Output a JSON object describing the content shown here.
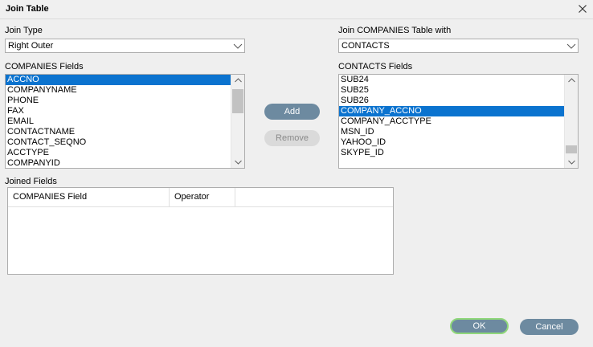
{
  "window": {
    "title": "Join Table",
    "close_icon": "close-icon"
  },
  "join_type": {
    "label": "Join Type",
    "value": "Right Outer"
  },
  "join_with": {
    "label": "Join COMPANIES Table with",
    "value": "CONTACTS"
  },
  "left_list": {
    "label": "COMPANIES Fields",
    "items": [
      "ACCNO",
      "COMPANYNAME",
      "PHONE",
      "FAX",
      "EMAIL",
      "CONTACTNAME",
      "CONTACT_SEQNO",
      "ACCTYPE",
      "COMPANYID"
    ],
    "selected_index": 0
  },
  "right_list": {
    "label": "CONTACTS Fields",
    "items": [
      "SUB24",
      "SUB25",
      "SUB26",
      "COMPANY_ACCNO",
      "COMPANY_ACCTYPE",
      "MSN_ID",
      "YAHOO_ID",
      "SKYPE_ID"
    ],
    "selected_index": 3
  },
  "buttons": {
    "add": "Add",
    "remove": "Remove",
    "ok": "OK",
    "cancel": "Cancel"
  },
  "joined": {
    "label": "Joined Fields",
    "columns": [
      "COMPANIES Field",
      "Operator"
    ]
  },
  "colors": {
    "selection": "#0b73cf",
    "button": "#6d8aa0",
    "ok_border": "#90d77a"
  }
}
